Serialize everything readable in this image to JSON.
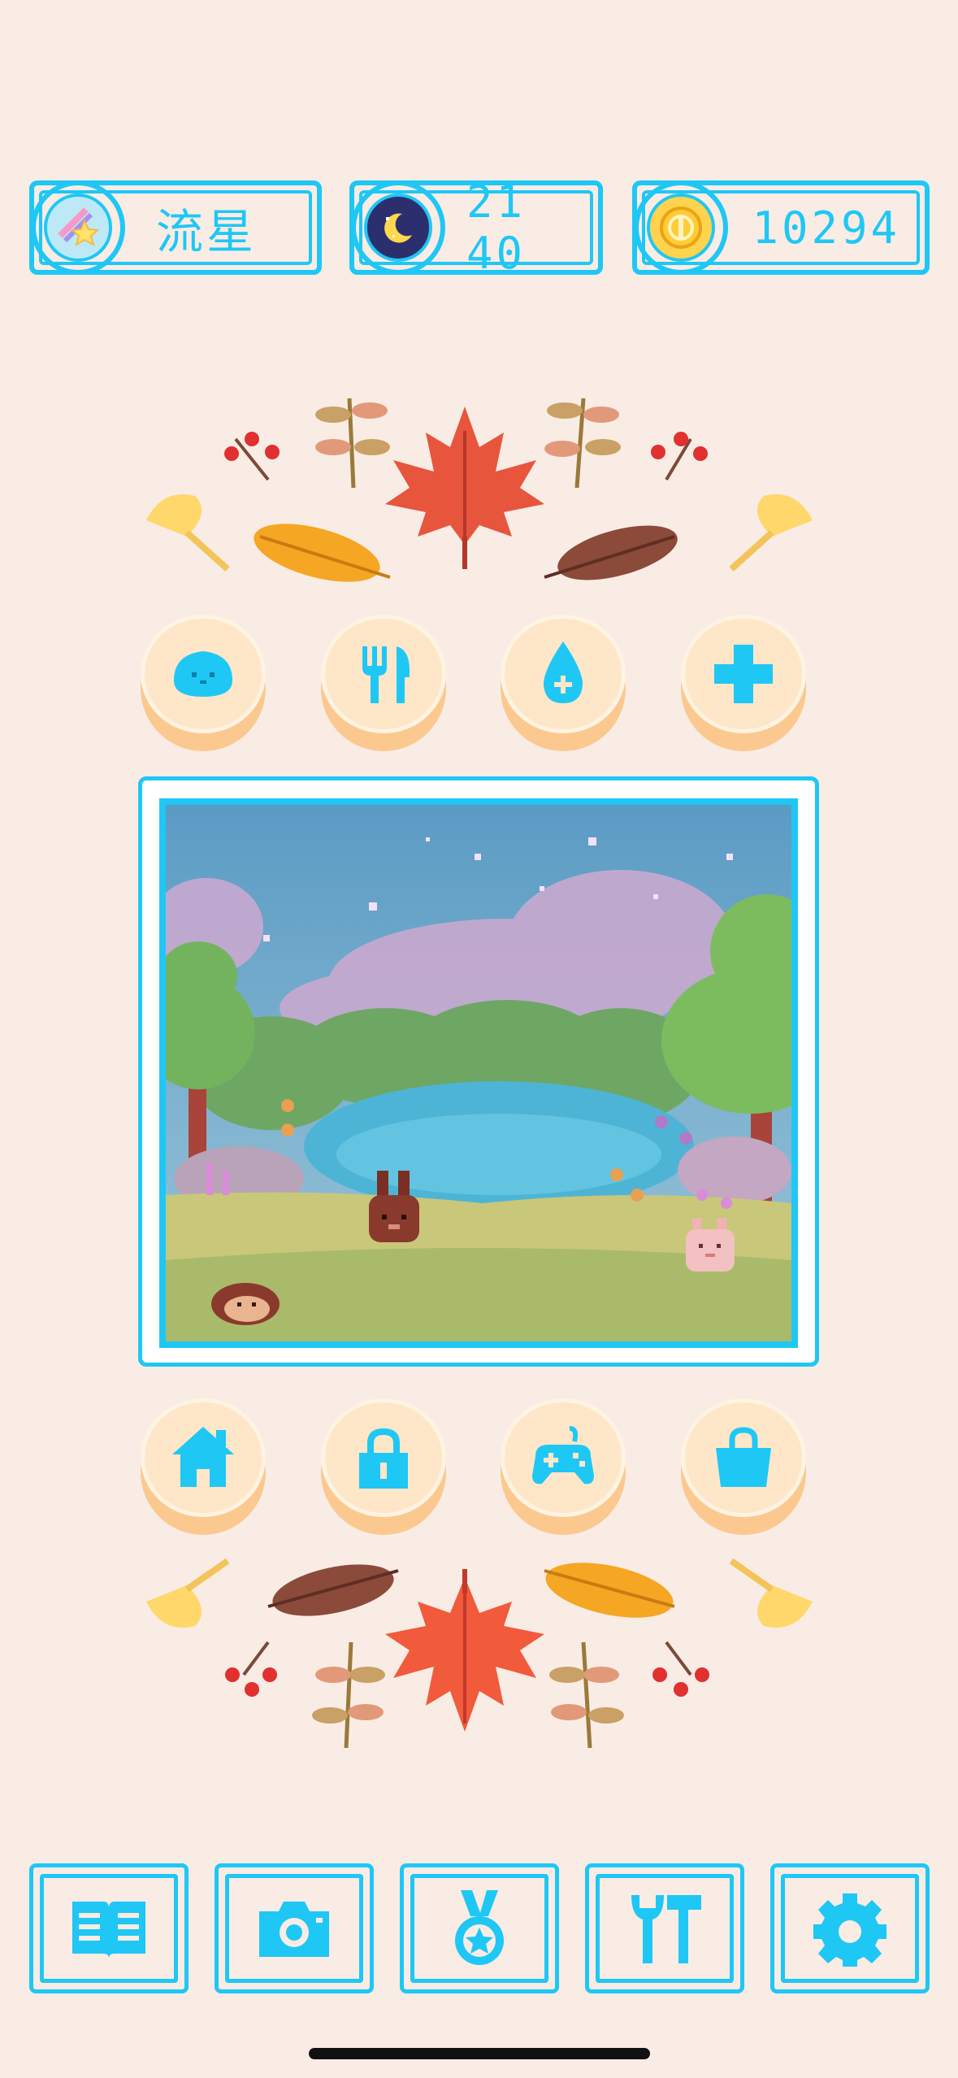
{
  "status": {
    "name": "流星",
    "time": "21 40",
    "coins": "10294",
    "name_icon": "shooting-star-icon",
    "time_icon": "moon-icon",
    "coins_icon": "coin-icon"
  },
  "action_buttons_top": [
    {
      "icon": "pet-face-icon"
    },
    {
      "icon": "fork-knife-icon"
    },
    {
      "icon": "water-drop-icon"
    },
    {
      "icon": "plus-icon"
    }
  ],
  "action_buttons_bottom": [
    {
      "icon": "house-icon"
    },
    {
      "icon": "lock-icon"
    },
    {
      "icon": "gamepad-icon"
    },
    {
      "icon": "shopping-bag-icon"
    }
  ],
  "bottom_nav": [
    {
      "icon": "book-icon"
    },
    {
      "icon": "camera-icon"
    },
    {
      "icon": "medal-icon"
    },
    {
      "icon": "tools-icon"
    },
    {
      "icon": "gear-icon"
    }
  ],
  "colors": {
    "background": "#f9ece5",
    "accent": "#1fc7f5",
    "button_face": "#fde7c8",
    "button_base": "#fbc98f"
  }
}
